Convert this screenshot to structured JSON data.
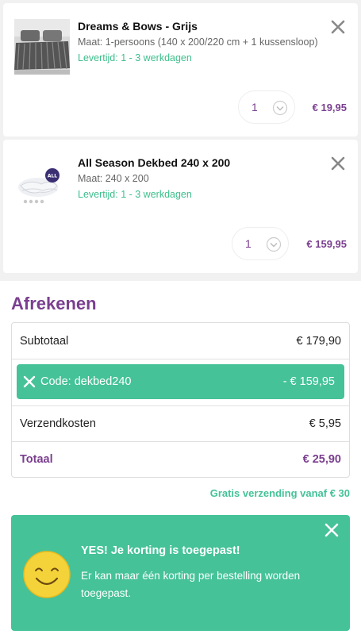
{
  "cart": {
    "items": [
      {
        "name": "Dreams & Bows - Grijs",
        "size": "Maat: 1-persoons (140 x 200/220 cm + 1 kussensloop)",
        "delivery": "Levertijd: 1 - 3 werkdagen",
        "quantity": "1",
        "price": "€ 19,95"
      },
      {
        "name": "All Season Dekbed 240 x 200",
        "size": "Maat: 240 x 200",
        "delivery": "Levertijd: 1 - 3 werkdagen",
        "quantity": "1",
        "price": "€ 159,95",
        "image_badge": "ALL"
      }
    ]
  },
  "checkout": {
    "title": "Afrekenen",
    "subtotal_label": "Subtotaal",
    "subtotal_value": "€ 179,90",
    "discount_code_label": "Code: dekbed240",
    "discount_value": "- € 159,95",
    "shipping_label": "Verzendkosten",
    "shipping_value": "€ 5,95",
    "total_label": "Totaal",
    "total_value": "€ 25,90",
    "free_shipping_note": "Gratis verzending vanaf € 30"
  },
  "notification": {
    "heading": "YES! Je korting is toegepast!",
    "message": "Er kan maar één korting per bestelling worden toegepast.",
    "icon": "smiley-icon"
  },
  "colors": {
    "accent_purple": "#7a3f8f",
    "accent_green": "#45c298",
    "delivery_green": "#3cbf8c"
  }
}
